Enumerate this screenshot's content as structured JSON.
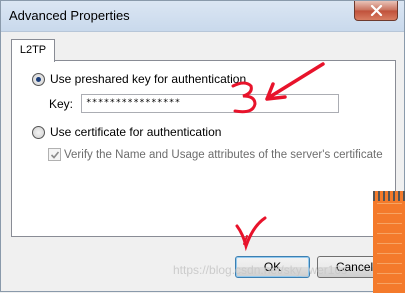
{
  "window": {
    "title": "Advanced Properties"
  },
  "tabs": [
    {
      "label": "L2TP"
    }
  ],
  "options": {
    "preshared_label": "Use preshared key for authentication",
    "preshared_selected": true,
    "key_label": "Key:",
    "key_value": "****************",
    "certificate_label": "Use certificate for authentication",
    "certificate_selected": false,
    "verify_label": "Verify the Name and Usage attributes of the server's certificate",
    "verify_checked": true,
    "verify_enabled": false
  },
  "buttons": {
    "ok_label": "OK",
    "cancel_label": "Cancel"
  },
  "annotations": {
    "digit_label": "3",
    "check_mark_label": "√"
  },
  "watermark": "https://blog.csdn.net/sky_wer16s",
  "colors": {
    "annotation_red": "#e8132b",
    "title_bar": "#c9d9ec",
    "close_button": "#c0503a",
    "notepad_orange": "#f47a2b"
  }
}
